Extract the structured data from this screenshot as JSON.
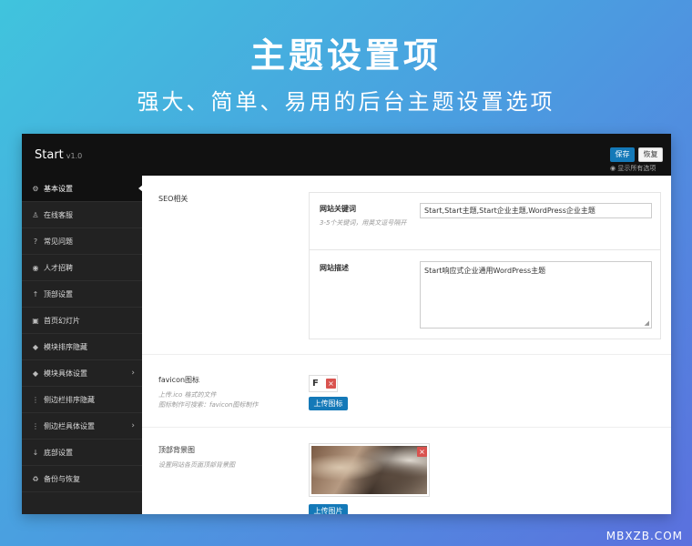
{
  "hero": {
    "title": "主题设置项",
    "subtitle": "强大、简单、易用的后台主题设置选项"
  },
  "app": {
    "brand": "Start",
    "version": "v1.0",
    "save_label": "保存",
    "restore_label": "恢复",
    "show_all_label": "显示所有选项"
  },
  "sidebar": {
    "items": [
      {
        "label": "基本设置",
        "icon": "gear-icon",
        "glyph": "⚙"
      },
      {
        "label": "在线客服",
        "icon": "user-icon",
        "glyph": "♙"
      },
      {
        "label": "常见问题",
        "icon": "question-icon",
        "glyph": "?"
      },
      {
        "label": "人才招聘",
        "icon": "eye-icon",
        "glyph": "◉"
      },
      {
        "label": "顶部设置",
        "icon": "arrow-up-icon",
        "glyph": "↑"
      },
      {
        "label": "首页幻灯片",
        "icon": "image-icon",
        "glyph": "▣"
      },
      {
        "label": "模块排序隐藏",
        "icon": "cube-icon",
        "glyph": "◆"
      },
      {
        "label": "模块具体设置",
        "icon": "cube-icon",
        "glyph": "◆"
      },
      {
        "label": "侧边栏排序隐藏",
        "icon": "vertical-bar-icon",
        "glyph": "⋮"
      },
      {
        "label": "侧边栏具体设置",
        "icon": "vertical-bar-icon",
        "glyph": "⋮"
      },
      {
        "label": "底部设置",
        "icon": "arrow-down-icon",
        "glyph": "↓"
      },
      {
        "label": "备份与恢复",
        "icon": "recycle-icon",
        "glyph": "♻"
      }
    ]
  },
  "seo": {
    "section_label": "SEO相关",
    "keywords_label": "网站关键词",
    "keywords_desc": "3-5个关键词，用英文逗号隔开",
    "keywords_value": "Start,Start主题,Start企业主题,WordPress企业主题",
    "description_label": "网站描述",
    "description_value": "Start响应式企业通用WordPress主题"
  },
  "favicon": {
    "label": "favicon图标",
    "desc_line1": "上传.ico 格式的文件",
    "desc_line2": "图标制作可搜索：favicon图标制作",
    "button_label": "上传图标"
  },
  "top_bg": {
    "label": "顶部背景图",
    "desc": "设置网站各页面顶部背景图",
    "button_label": "上传图片"
  },
  "watermark": "MBXZB.COM",
  "colors": {
    "primary_button": "#1479b8",
    "delete": "#d9534f",
    "topbar": "#111111",
    "sidebar": "#222222"
  }
}
